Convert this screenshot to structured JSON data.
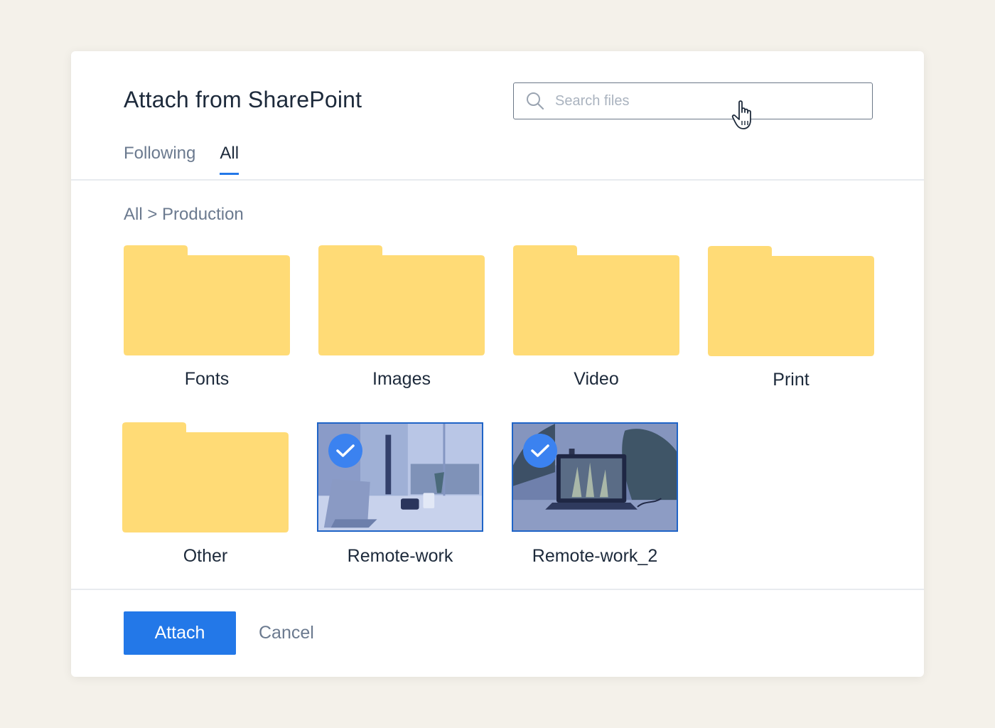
{
  "dialog": {
    "title": "Attach from SharePoint",
    "search": {
      "placeholder": "Search files",
      "value": ""
    },
    "tabs": [
      {
        "label": "Following",
        "active": false
      },
      {
        "label": "All",
        "active": true
      }
    ],
    "breadcrumb": "All > Production",
    "items": [
      {
        "type": "folder",
        "name": "Fonts"
      },
      {
        "type": "folder",
        "name": "Images"
      },
      {
        "type": "folder",
        "name": "Video"
      },
      {
        "type": "folder",
        "name": "Print"
      },
      {
        "type": "folder",
        "name": "Other"
      },
      {
        "type": "image",
        "name": "Remote-work",
        "selected": true
      },
      {
        "type": "image",
        "name": "Remote-work_2",
        "selected": true
      }
    ],
    "actions": {
      "attach_label": "Attach",
      "cancel_label": "Cancel"
    }
  },
  "colors": {
    "background": "#f4f1ea",
    "accent": "#2378e8",
    "folder": "#ffdb76",
    "selection_border": "#1f64c7",
    "check_badge": "#3b82f0"
  },
  "icons": {
    "search": "search-icon",
    "cursor": "hand-pointer-icon",
    "folder": "folder-icon",
    "selected": "checkmark-icon"
  }
}
